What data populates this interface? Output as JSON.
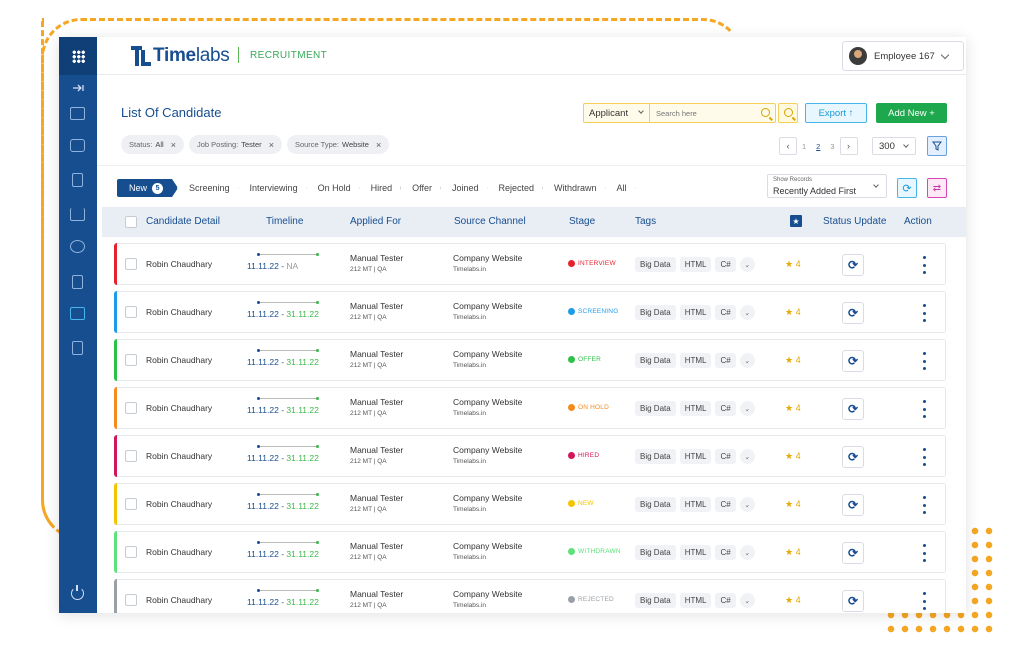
{
  "header": {
    "logo_bold": "Time",
    "logo_light": "labs",
    "module": "RECRUITMENT",
    "user": "Employee 167"
  },
  "page": {
    "title": "List Of Candidate",
    "search_scope": "Applicant",
    "search_placeholder": "Search here",
    "export_label": "Export ↑",
    "add_new_label": "Add New +"
  },
  "filters": [
    {
      "label": "Status:",
      "value": "All"
    },
    {
      "label": "Job Posting:",
      "value": "Tester"
    },
    {
      "label": "Source Type:",
      "value": "Website"
    }
  ],
  "pagination": {
    "pages": [
      "1",
      "2",
      "3"
    ],
    "current": "2",
    "per_page": "300"
  },
  "stages": [
    {
      "label": "New",
      "count": "5"
    },
    {
      "label": "Screening"
    },
    {
      "label": "Interviewing"
    },
    {
      "label": "On Hold"
    },
    {
      "label": "Hired"
    },
    {
      "label": "Offer"
    },
    {
      "label": "Joined"
    },
    {
      "label": "Rejected"
    },
    {
      "label": "Withdrawn"
    },
    {
      "label": "All"
    }
  ],
  "sort": {
    "label": "Show Records",
    "value": "Recently Added First"
  },
  "table": {
    "headers": [
      "Candidate Detail",
      "Timeline",
      "Applied For",
      "Source Channel",
      "Stage",
      "Tags",
      "Status Update",
      "Action"
    ]
  },
  "rows": [
    {
      "name": "Robin Chaudhary",
      "start": "11.11.22",
      "end": "NA",
      "end_na": true,
      "job": "Manual Tester",
      "job_meta": "212 MT  |  QA",
      "source": "Company Website",
      "source_meta": "Timelabs.in",
      "stage": "INTERVIEW",
      "stage_color": "#e5232f",
      "accent": "#e5232f",
      "tags": [
        "Big Data",
        "HTML",
        "C#"
      ],
      "rating": "★ 4"
    },
    {
      "name": "Robin Chaudhary",
      "start": "11.11.22",
      "end": "31.11.22",
      "job": "Manual Tester",
      "job_meta": "212 MT  |  QA",
      "source": "Company Website",
      "source_meta": "Timelabs.in",
      "stage": "SCREENING",
      "stage_color": "#1e9be8",
      "accent": "#1e9be8",
      "tags": [
        "Big Data",
        "HTML",
        "C#"
      ],
      "rating": "★ 4"
    },
    {
      "name": "Robin Chaudhary",
      "start": "11.11.22",
      "end": "31.11.22",
      "job": "Manual Tester",
      "job_meta": "212 MT  |  QA",
      "source": "Company Website",
      "source_meta": "Timelabs.in",
      "stage": "OFFER",
      "stage_color": "#2ec14a",
      "accent": "#2ec14a",
      "tags": [
        "Big Data",
        "HTML",
        "C#"
      ],
      "rating": "★ 4"
    },
    {
      "name": "Robin Chaudhary",
      "start": "11.11.22",
      "end": "31.11.22",
      "job": "Manual Tester",
      "job_meta": "212 MT  |  QA",
      "source": "Company Website",
      "source_meta": "Timelabs.in",
      "stage": "ON HOLD",
      "stage_color": "#f58a1f",
      "accent": "#f58a1f",
      "tags": [
        "Big Data",
        "HTML",
        "C#"
      ],
      "rating": "★ 4"
    },
    {
      "name": "Robin Chaudhary",
      "start": "11.11.22",
      "end": "31.11.22",
      "job": "Manual Tester",
      "job_meta": "212 MT  |  QA",
      "source": "Company Website",
      "source_meta": "Timelabs.in",
      "stage": "HIRED",
      "stage_color": "#d4145a",
      "accent": "#d4145a",
      "tags": [
        "Big Data",
        "HTML",
        "C#"
      ],
      "rating": "★ 4"
    },
    {
      "name": "Robin Chaudhary",
      "start": "11.11.22",
      "end": "31.11.22",
      "job": "Manual Tester",
      "job_meta": "212 MT  |  QA",
      "source": "Company Website",
      "source_meta": "Timelabs.in",
      "stage": "NEW",
      "stage_color": "#f5c400",
      "accent": "#f5c400",
      "tags": [
        "Big Data",
        "HTML",
        "C#"
      ],
      "rating": "★ 4"
    },
    {
      "name": "Robin Chaudhary",
      "start": "11.11.22",
      "end": "31.11.22",
      "job": "Manual Tester",
      "job_meta": "212 MT  |  QA",
      "source": "Company Website",
      "source_meta": "Timelabs.in",
      "stage": "WITHDRAWN",
      "stage_color": "#5ee07a",
      "accent": "#5ee07a",
      "tags": [
        "Big Data",
        "HTML",
        "C#"
      ],
      "rating": "★ 4"
    },
    {
      "name": "Robin Chaudhary",
      "start": "11.11.22",
      "end": "31.11.22",
      "job": "Manual Tester",
      "job_meta": "212 MT  |  QA",
      "source": "Company Website",
      "source_meta": "Timelabs.in",
      "stage": "REJECTED",
      "stage_color": "#9aa0a6",
      "accent": "#9aa0a6",
      "tags": [
        "Big Data",
        "HTML",
        "C#"
      ],
      "rating": "★ 4"
    }
  ]
}
